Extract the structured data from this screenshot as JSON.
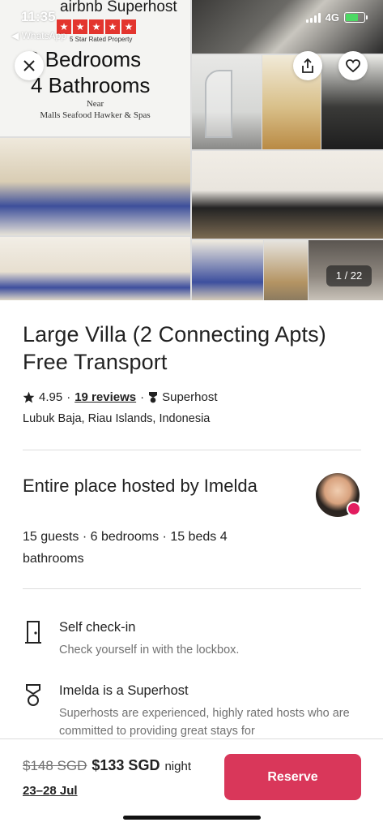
{
  "status_bar": {
    "time": "11:35",
    "back_label": "◀ WhatsApp",
    "network": "4G"
  },
  "gallery": {
    "promo": {
      "brand": "airbnb Superhost",
      "star_count": 5,
      "rated_text": "5 Star Rated Property",
      "line1": "6 Bedrooms",
      "line2": "4 Bathrooms",
      "line3": "Near",
      "line4": "Malls Seafood Hawker & Spas"
    },
    "counter": "1 / 22"
  },
  "listing": {
    "title": "Large Villa (2 Connecting Apts) Free Transport",
    "rating": "4.95",
    "reviews": "19 reviews",
    "separator": "·",
    "superhost": "Superhost",
    "location": "Lubuk Baja, Riau Islands, Indonesia"
  },
  "host": {
    "heading": "Entire place hosted by Imelda",
    "details": "15 guests · 6 bedrooms · 15 beds 4 bathrooms"
  },
  "features": [
    {
      "icon": "door-icon",
      "title": "Self check-in",
      "desc": "Check yourself in with the lockbox."
    },
    {
      "icon": "medal-icon",
      "title": "Imelda is a Superhost",
      "desc": "Superhosts are experienced, highly rated hosts who are committed to providing great stays for"
    }
  ],
  "footer": {
    "old_price": "$148 SGD",
    "new_price": "$133 SGD",
    "per": "night",
    "dates": "23–28 Jul",
    "reserve_label": "Reserve"
  },
  "colors": {
    "accent": "#d9375a",
    "text": "#222222",
    "muted": "#717171",
    "divider": "#dddddd"
  }
}
